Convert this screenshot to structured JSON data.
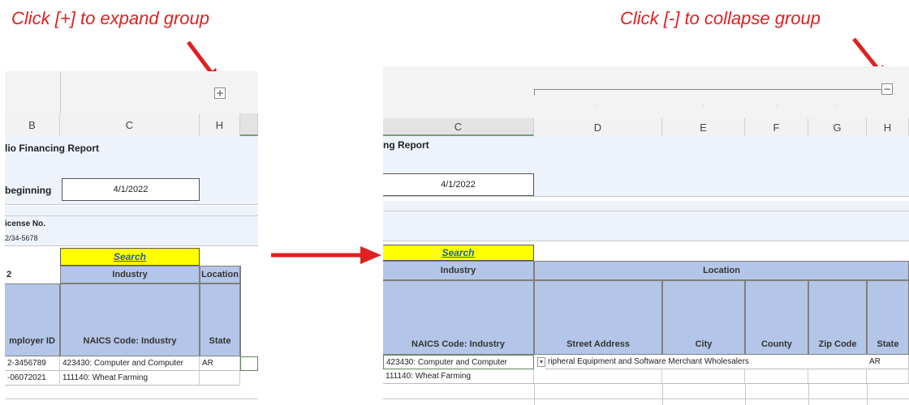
{
  "annotations": {
    "expand_caption": "Click [+] to expand group",
    "collapse_caption": "Click [-] to collapse group"
  },
  "colors": {
    "annotation": "#e02020",
    "header_blue": "#b4c6e7",
    "search_yellow": "#ffff00",
    "link": "#1f5fb0"
  },
  "left_panel": {
    "expand_button": "+",
    "columns": [
      "B",
      "C",
      "H"
    ],
    "title_fragment": "lio Financing Report",
    "beginning_label": "beginning",
    "date_value": "4/1/2022",
    "license_label": "icense No.",
    "license_value": "2/34-5678",
    "search_label": "Search",
    "row_number": "2",
    "industry_header": "Industry",
    "location_header": "Location",
    "employer_id_header": "mployer ID",
    "naics_header": "NAICS Code: Industry",
    "state_header": "State",
    "rows": [
      {
        "employer_id": "2-3456789",
        "naics": "423430: Computer and Computer",
        "state": "AR"
      },
      {
        "employer_id": "-06072021",
        "naics": "111140: Wheat Farming",
        "state": ""
      }
    ]
  },
  "right_panel": {
    "collapse_button": "−",
    "columns": [
      "C",
      "D",
      "E",
      "F",
      "G",
      "H"
    ],
    "title_fragment": "ng Report",
    "date_value": "4/1/2022",
    "search_label": "Search",
    "industry_header": "Industry",
    "location_header": "Location",
    "naics_header": "NAICS Code: Industry",
    "street_header": "Street Address",
    "city_header": "City",
    "county_header": "County",
    "zip_header": "Zip Code",
    "state_header": "State",
    "rows": [
      {
        "naics": "423430: Computer and Computer",
        "address": "ripheral Equipment and Software Merchant Wholesalers",
        "state": "AR"
      },
      {
        "naics": "111140: Wheat Farming",
        "address": "",
        "state": ""
      }
    ]
  }
}
